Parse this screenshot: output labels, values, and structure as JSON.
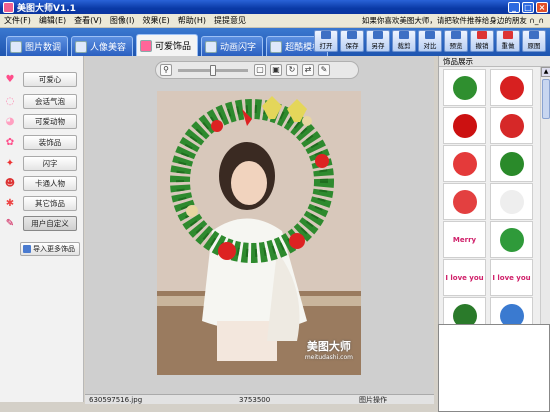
{
  "window": {
    "title": "美图大师V1.1"
  },
  "menu": {
    "items": [
      "文件(F)",
      "编辑(E)",
      "查看(V)",
      "图像(I)",
      "效果(E)",
      "帮助(H)",
      "提提意见"
    ],
    "message": "如果你喜欢美图大师，请把软件推荐给身边的朋友 ∩_∩"
  },
  "tabs": [
    {
      "label": "图片数调",
      "active": false
    },
    {
      "label": "人像美容",
      "active": false
    },
    {
      "label": "可爱饰品",
      "active": true
    },
    {
      "label": "动画闪字",
      "active": false
    },
    {
      "label": "超酷模板",
      "active": false
    }
  ],
  "toolbar": [
    "打开",
    "保存",
    "另存",
    "裁剪",
    "对比",
    "预览",
    "撤销",
    "重做",
    "原图"
  ],
  "categories": [
    {
      "label": "可爱心",
      "icon": "heart-icon",
      "color": "#ff4d8a",
      "glyph": "♥"
    },
    {
      "label": "会话气泡",
      "icon": "speech-bubble-icon",
      "color": "#ff7aa8",
      "glyph": "◌"
    },
    {
      "label": "可爱动物",
      "icon": "cat-face-icon",
      "color": "#ff9fc0",
      "glyph": "◕"
    },
    {
      "label": "装饰品",
      "icon": "bow-icon",
      "color": "#ff4d8a",
      "glyph": "✿"
    },
    {
      "label": "闪字",
      "icon": "sparkle-text-icon",
      "color": "#e33",
      "glyph": "✦"
    },
    {
      "label": "卡通人物",
      "icon": "cartoon-face-icon",
      "color": "#d33",
      "glyph": "☻"
    },
    {
      "label": "其它饰品",
      "icon": "gift-icon",
      "color": "#ee4444",
      "glyph": "✱"
    },
    {
      "label": "用户自定义",
      "icon": "custom-icon",
      "color": "#c04",
      "glyph": "✎"
    }
  ],
  "import_button": "导入更多饰品",
  "rightpanel": {
    "title": "饰品展示",
    "items": [
      {
        "name": "christmas-wreath-icon",
        "text": "",
        "bg": "#2f8f2f"
      },
      {
        "name": "santa-hat-icon",
        "text": "",
        "bg": "#d72020"
      },
      {
        "name": "red-ornament-icon",
        "text": "",
        "bg": "#cc1111"
      },
      {
        "name": "red-mitten-icon",
        "text": "",
        "bg": "#d62828"
      },
      {
        "name": "candy-cane-icon",
        "text": "",
        "bg": "#e43a3a"
      },
      {
        "name": "christmas-tree-icon",
        "text": "",
        "bg": "#2a8a2a"
      },
      {
        "name": "merry-xmas-snowman-icon",
        "text": "",
        "bg": "#e34040"
      },
      {
        "name": "snowman-icon",
        "text": "",
        "bg": "#eeeeee"
      },
      {
        "name": "merry-christmas-text-icon",
        "text": "Merry",
        "bg": "#ffffff"
      },
      {
        "name": "christmas-tree-small-icon",
        "text": "",
        "bg": "#2f9a3a"
      },
      {
        "name": "i-love-you-text-1",
        "text": "I love you",
        "bg": "#ffffff"
      },
      {
        "name": "i-love-you-text-2",
        "text": "I love you",
        "bg": "#ffffff"
      },
      {
        "name": "christmas-tree-decor-icon",
        "text": "",
        "bg": "#2a7a2a"
      },
      {
        "name": "blue-bird-icon",
        "text": "",
        "bg": "#3a7ad0"
      }
    ]
  },
  "photo": {
    "watermark_main": "美图大师",
    "watermark_sub": "meitudashi.com"
  },
  "status": {
    "filename": "630597516.jpg",
    "size": "3753500",
    "mode": "图片操作"
  }
}
